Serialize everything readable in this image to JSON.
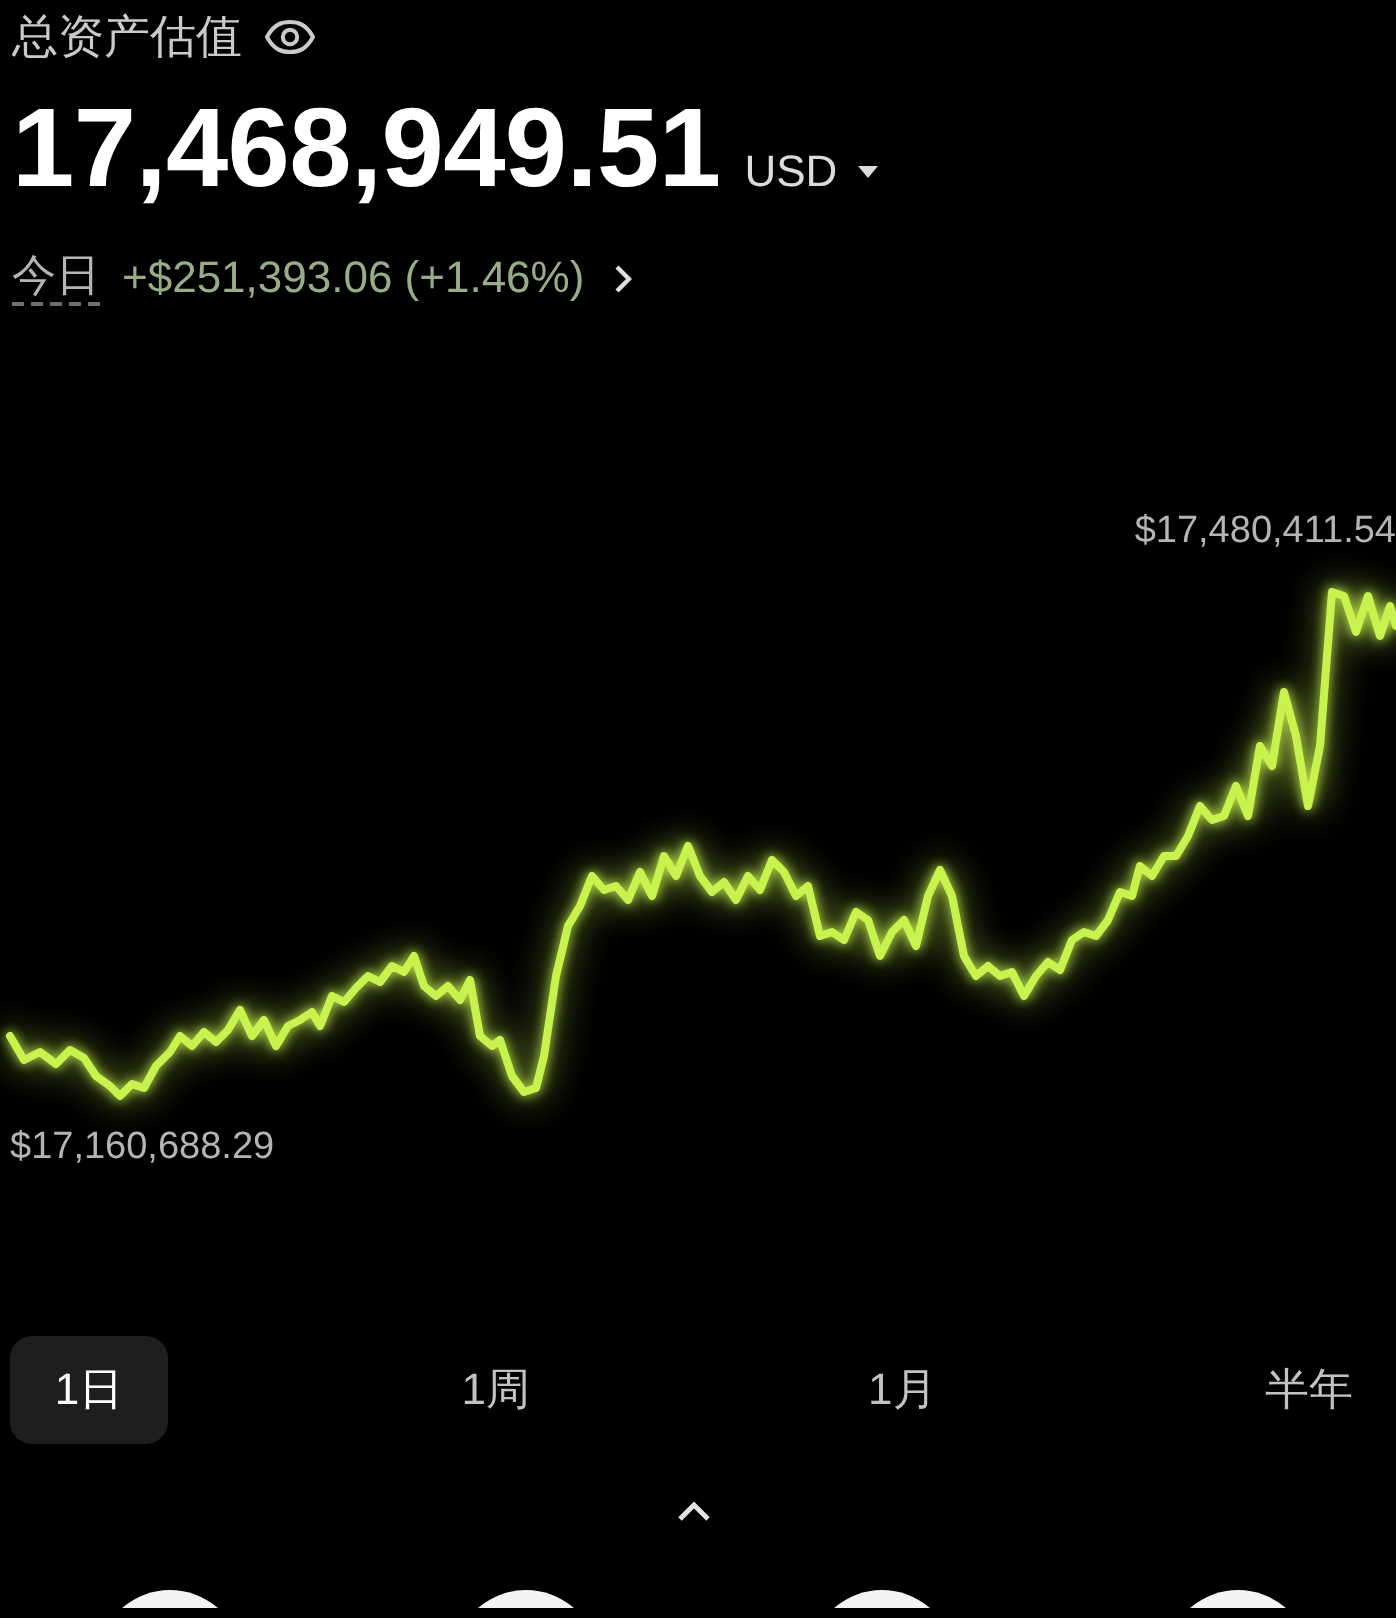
{
  "header": {
    "title": "总资产估值",
    "balance": "17,468,949.51",
    "currency": "USD",
    "period_label": "今日",
    "change": "+$251,393.06 (+1.46%)"
  },
  "chart": {
    "high_label": "$17,480,411.54",
    "low_label": "$17,160,688.29"
  },
  "ranges": [
    {
      "label": "1日",
      "selected": true
    },
    {
      "label": "1周",
      "selected": false
    },
    {
      "label": "1月",
      "selected": false
    },
    {
      "label": "半年",
      "selected": false
    }
  ]
}
